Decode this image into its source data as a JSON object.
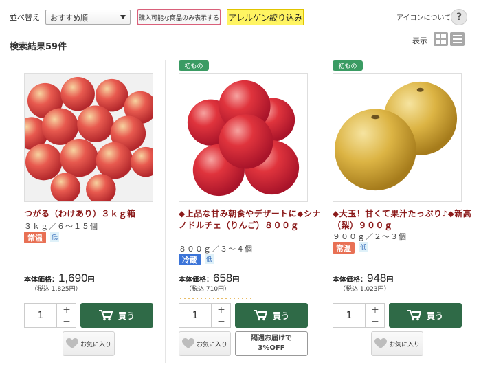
{
  "toolbar": {
    "sort_label": "並べ替え",
    "sort_value": "おすすめ順",
    "purchasable_only": "購入可能な商品のみ表示する",
    "allergen_filter": "アレルゲン絞り込み",
    "icon_about": "アイコンについて",
    "help_symbol": "?"
  },
  "results": {
    "count_text": "検索結果59件",
    "display_label": "表示"
  },
  "common": {
    "price_label": "本体価格：",
    "yen": "円",
    "plus": "＋",
    "minus": "－",
    "buy": "買う",
    "favorite": "お気に入り"
  },
  "products": [
    {
      "badge": "",
      "name": "つがる（わけあり）３ｋｇ箱",
      "spec": "３ｋｇ／６～１５個",
      "temp": "常温",
      "low": "低",
      "price": "1,690",
      "tax": "（税込 1,825円）",
      "qty": "1"
    },
    {
      "badge": "初もの",
      "name": "◆上品な甘み朝食やデザートに◆シナノドルチェ（りんご）８００ｇ",
      "spec": "８００ｇ／３～４個",
      "temp": "冷蔵",
      "low": "低",
      "price": "658",
      "tax": "（税込 710円）",
      "qty": "1",
      "weekly_line1": "隔週お届けで",
      "weekly_line2": "3%OFF"
    },
    {
      "badge": "初もの",
      "name": "◆大玉！甘くて果汁たっぷり♪◆新高（梨）９００ｇ",
      "spec": "９００ｇ／２～３個",
      "temp": "常温",
      "low": "低",
      "price": "948",
      "tax": "（税込 1,023円）",
      "qty": "1"
    }
  ],
  "colors": {
    "product_name": "#8b1a1a",
    "buy_button": "#2f6a47",
    "new_badge": "#3a9b63",
    "temp_normal": "#e87054",
    "temp_cold": "#3b74d8",
    "allergen_bg": "#fff462",
    "purchasable_border": "#d9607a"
  },
  "icons": [
    "chevron-down-icon",
    "help-icon",
    "grid-view-icon",
    "list-view-icon",
    "cart-icon",
    "heart-icon"
  ]
}
